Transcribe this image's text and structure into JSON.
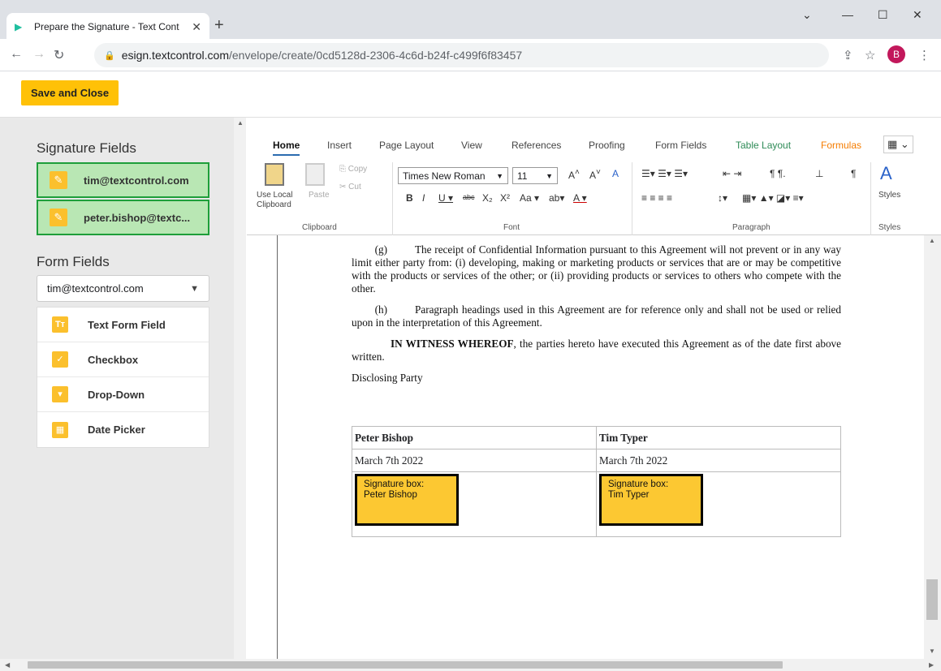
{
  "browser": {
    "tab_title": "Prepare the Signature - Text Cont",
    "tab_close": "✕",
    "new_tab": "+",
    "url_host": "esign.textcontrol.com",
    "url_path": "/envelope/create/0cd5128d-2306-4c6d-b24f-c499f6f83457",
    "profile_initial": "B"
  },
  "appbar": {
    "save_label": "Save and Close"
  },
  "sidebar": {
    "signature_heading": "Signature Fields",
    "signature_fields": [
      {
        "label": "tim@textcontrol.com"
      },
      {
        "label": "peter.bishop@textc..."
      }
    ],
    "form_heading": "Form Fields",
    "signer_select": "tim@textcontrol.com",
    "form_fields": [
      {
        "label": "Text Form Field",
        "icon": "text-field-icon",
        "glyph": "Tт"
      },
      {
        "label": "Checkbox",
        "icon": "checkbox-icon",
        "glyph": "✓"
      },
      {
        "label": "Drop-Down",
        "icon": "dropdown-icon",
        "glyph": "▾"
      },
      {
        "label": "Date Picker",
        "icon": "calendar-icon",
        "glyph": "▦"
      }
    ]
  },
  "ribbon": {
    "tabs": [
      "Home",
      "Insert",
      "Page Layout",
      "View",
      "References",
      "Proofing",
      "Form Fields",
      "Table Layout",
      "Formulas"
    ],
    "clipboard": {
      "use_local": "Use Local",
      "clipboard": "Clipboard",
      "paste": "Paste",
      "copy": "Copy",
      "cut": "Cut",
      "group": "Clipboard"
    },
    "font": {
      "name": "Times New Roman",
      "size": "11",
      "group": "Font"
    },
    "paragraph": {
      "group": "Paragraph"
    },
    "styles": {
      "label": "Styles",
      "group": "Styles"
    }
  },
  "document": {
    "para_g_marker": "(g)",
    "para_g": "The receipt of Confidential Information pursuant to this Agreement will not prevent or in any way limit either party from: (i) developing, making or marketing products or services that are or may be competitive with the products or services of the other; or (ii) providing products or services to others who compete with the other.",
    "para_h_marker": "(h)",
    "para_h": "Paragraph headings used in this Agreement are for reference only and shall not be used or relied upon in the interpretation of this Agreement.",
    "witness_bold": "IN WITNESS WHEREOF",
    "witness_rest": ", the parties hereto have executed this Agreement as of the date first above written.",
    "disclosing": "Disclosing Party",
    "table": {
      "names": [
        "Peter Bishop",
        "Tim Typer"
      ],
      "dates": [
        "March 7th 2022",
        "March 7th 2022"
      ],
      "boxes": [
        {
          "line1": "Signature box:",
          "line2": "Peter Bishop"
        },
        {
          "line1": "Signature box:",
          "line2": "Tim Typer"
        }
      ]
    }
  }
}
